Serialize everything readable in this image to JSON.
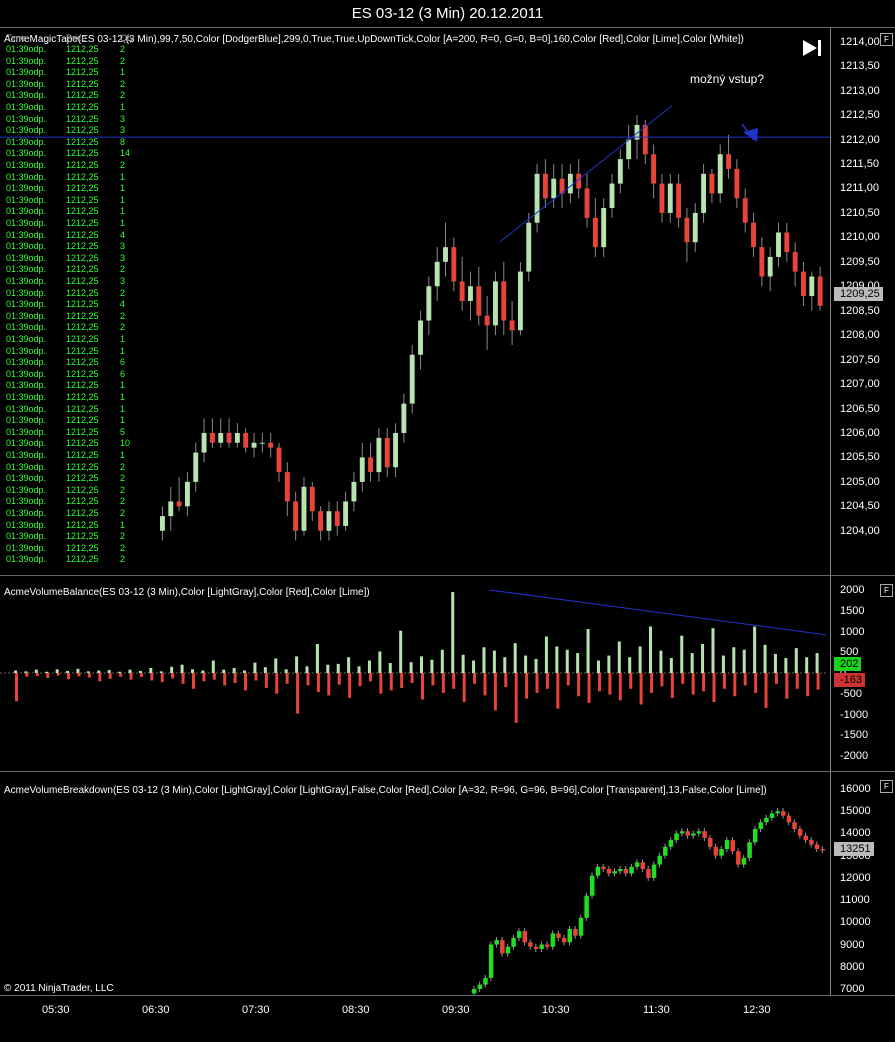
{
  "window": {
    "title": "ES 03-12 (3 Min)  20.12.2011"
  },
  "price_pane": {
    "indicator_label": "AcmeMagicTape(ES 03-12 (3 Min),99,7,50,Color [DodgerBlue],299,0,True,True,UpDownTick,Color [A=200, R=0, G=0, B=0],160,Color [Red],Color [Lime],Color [White])",
    "tape_header": [
      "Time",
      "Price",
      "Qty"
    ],
    "y_ticks": [
      "1214,00",
      "1213,50",
      "1213,00",
      "1212,50",
      "1212,00",
      "1211,50",
      "1211,00",
      "1210,50",
      "1210,00",
      "1209,50",
      "1209,00",
      "1208,50",
      "1208,00",
      "1207,50",
      "1207,00",
      "1206,50",
      "1206,00",
      "1205,50",
      "1205,00",
      "1204,50",
      "1204,00"
    ],
    "current_price": "1209,25",
    "annotation": "možný vstup?",
    "tape_rows": [
      [
        "01:39odp.",
        "1212,25",
        "2"
      ],
      [
        "01:39odp.",
        "1212,25",
        "2"
      ],
      [
        "01:39odp.",
        "1212,25",
        "1"
      ],
      [
        "01:39odp.",
        "1212,25",
        "2"
      ],
      [
        "01:39odp.",
        "1212,25",
        "2"
      ],
      [
        "01:39odp.",
        "1212,25",
        "1"
      ],
      [
        "01:39odp.",
        "1212,25",
        "3"
      ],
      [
        "01:39odp.",
        "1212,25",
        "3"
      ],
      [
        "01:39odp.",
        "1212,25",
        "8"
      ],
      [
        "01:39odp.",
        "1212,25",
        "14"
      ],
      [
        "01:39odp.",
        "1212,25",
        "2"
      ],
      [
        "01:39odp.",
        "1212,25",
        "1"
      ],
      [
        "01:39odp.",
        "1212,25",
        "1"
      ],
      [
        "01:39odp.",
        "1212,25",
        "1"
      ],
      [
        "01:39odp.",
        "1212,25",
        "1"
      ],
      [
        "01:39odp.",
        "1212,25",
        "1"
      ],
      [
        "01:39odp.",
        "1212,25",
        "4"
      ],
      [
        "01:39odp.",
        "1212,25",
        "3"
      ],
      [
        "01:39odp.",
        "1212,25",
        "3"
      ],
      [
        "01:39odp.",
        "1212,25",
        "2"
      ],
      [
        "01:39odp.",
        "1212,25",
        "3"
      ],
      [
        "01:39odp.",
        "1212,25",
        "2"
      ],
      [
        "01:39odp.",
        "1212,25",
        "4"
      ],
      [
        "01:39odp.",
        "1212,25",
        "2"
      ],
      [
        "01:39odp.",
        "1212,25",
        "2"
      ],
      [
        "01:39odp.",
        "1212,25",
        "1"
      ],
      [
        "01:39odp.",
        "1212,25",
        "1"
      ],
      [
        "01:39odp.",
        "1212,25",
        "6"
      ],
      [
        "01:39odp.",
        "1212,25",
        "6"
      ],
      [
        "01:39odp.",
        "1212,25",
        "1"
      ],
      [
        "01:39odp.",
        "1212,25",
        "1"
      ],
      [
        "01:39odp.",
        "1212,25",
        "1"
      ],
      [
        "01:39odp.",
        "1212,25",
        "1"
      ],
      [
        "01:39odp.",
        "1212,25",
        "5"
      ],
      [
        "01:39odp.",
        "1212,25",
        "10"
      ],
      [
        "01:39odp.",
        "1212,25",
        "1"
      ],
      [
        "01:39odp.",
        "1212,25",
        "2"
      ],
      [
        "01:39odp.",
        "1212,25",
        "2"
      ],
      [
        "01:39odp.",
        "1212,25",
        "2"
      ],
      [
        "01:39odp.",
        "1212,25",
        "2"
      ],
      [
        "01:39odp.",
        "1212,25",
        "2"
      ],
      [
        "01:39odp.",
        "1212,25",
        "1"
      ],
      [
        "01:39odp.",
        "1212,25",
        "2"
      ],
      [
        "01:39odp.",
        "1212,25",
        "2"
      ],
      [
        "01:39odp.",
        "1212,25",
        "2"
      ]
    ]
  },
  "balance_pane": {
    "indicator_label": "AcmeVolumeBalance(ES 03-12 (3 Min),Color [LightGray],Color [Red],Color [Lime])",
    "y_ticks": [
      "2000",
      "1500",
      "1000",
      "500",
      "0",
      "-500",
      "-1000",
      "-1500",
      "-2000"
    ],
    "buy_value": "202",
    "sell_value": "-163"
  },
  "breakdown_pane": {
    "indicator_label": "AcmeVolumeBreakdown(ES 03-12 (3 Min),Color [LightGray],Color [LightGray],False,Color [Red],Color [A=32, R=96, G=96, B=96],Color [Transparent],13,False,Color [Lime])",
    "y_ticks": [
      "16000",
      "15000",
      "14000",
      "13000",
      "12000",
      "11000",
      "10000",
      "9000",
      "8000",
      "7000"
    ],
    "current_value": "13251"
  },
  "x_axis": {
    "ticks": [
      "05:30",
      "06:30",
      "07:30",
      "08:30",
      "09:30",
      "10:30",
      "11:30",
      "12:30"
    ]
  },
  "footer": {
    "copyright": "© 2011 NinjaTrader, LLC"
  },
  "panel_button": "F",
  "colors": {
    "up": "#b7e3b0",
    "down": "#e8443a",
    "lime": "#22dd22",
    "trendline": "#2233cc",
    "tape_text": "#33ff33"
  },
  "chart_data": [
    {
      "type": "candlestick",
      "series_name": "ES 03-12 (3 Min)",
      "ylim": [
        1203.6,
        1214.3
      ],
      "x_ticks": [
        "05:30",
        "06:30",
        "07:30",
        "08:30",
        "09:30",
        "10:30",
        "11:30",
        "12:30"
      ],
      "candles_ohlc": [
        [
          1204.0,
          1204.5,
          1203.8,
          1204.3
        ],
        [
          1204.3,
          1204.9,
          1204.0,
          1204.6
        ],
        [
          1204.6,
          1205.1,
          1204.4,
          1204.5
        ],
        [
          1204.5,
          1205.2,
          1204.3,
          1205.0
        ],
        [
          1205.0,
          1205.8,
          1204.8,
          1205.6
        ],
        [
          1205.6,
          1206.3,
          1205.4,
          1206.0
        ],
        [
          1206.0,
          1206.3,
          1205.7,
          1205.8
        ],
        [
          1205.8,
          1206.3,
          1205.7,
          1206.0
        ],
        [
          1206.0,
          1206.3,
          1205.7,
          1205.8
        ],
        [
          1205.8,
          1206.2,
          1205.7,
          1206.0
        ],
        [
          1206.0,
          1206.1,
          1205.6,
          1205.7
        ],
        [
          1205.7,
          1206.0,
          1205.5,
          1205.8
        ],
        [
          1205.8,
          1206.0,
          1205.6,
          1205.8
        ],
        [
          1205.8,
          1206.0,
          1205.5,
          1205.7
        ],
        [
          1205.7,
          1205.8,
          1205.0,
          1205.2
        ],
        [
          1205.2,
          1205.4,
          1204.3,
          1204.6
        ],
        [
          1204.6,
          1204.8,
          1203.8,
          1204.0
        ],
        [
          1204.0,
          1205.1,
          1203.9,
          1204.9
        ],
        [
          1204.9,
          1205.0,
          1204.2,
          1204.4
        ],
        [
          1204.4,
          1204.5,
          1203.8,
          1204.0
        ],
        [
          1204.0,
          1204.6,
          1203.8,
          1204.4
        ],
        [
          1204.4,
          1204.6,
          1203.9,
          1204.1
        ],
        [
          1204.1,
          1204.8,
          1204.0,
          1204.6
        ],
        [
          1204.6,
          1205.2,
          1204.4,
          1205.0
        ],
        [
          1205.0,
          1205.8,
          1204.8,
          1205.5
        ],
        [
          1205.5,
          1205.8,
          1205.0,
          1205.2
        ],
        [
          1205.2,
          1206.1,
          1205.0,
          1205.9
        ],
        [
          1205.9,
          1206.1,
          1205.1,
          1205.3
        ],
        [
          1205.3,
          1206.2,
          1205.1,
          1206.0
        ],
        [
          1206.0,
          1206.8,
          1205.8,
          1206.6
        ],
        [
          1206.6,
          1207.8,
          1206.4,
          1207.6
        ],
        [
          1207.6,
          1208.5,
          1207.3,
          1208.3
        ],
        [
          1208.3,
          1209.2,
          1208.0,
          1209.0
        ],
        [
          1209.0,
          1209.8,
          1208.7,
          1209.5
        ],
        [
          1209.5,
          1210.3,
          1209.2,
          1209.8
        ],
        [
          1209.8,
          1210.0,
          1208.9,
          1209.1
        ],
        [
          1209.1,
          1209.6,
          1208.5,
          1208.7
        ],
        [
          1208.7,
          1209.3,
          1208.3,
          1209.0
        ],
        [
          1209.0,
          1209.4,
          1208.2,
          1208.4
        ],
        [
          1208.4,
          1208.8,
          1207.7,
          1208.2
        ],
        [
          1208.2,
          1209.3,
          1208.0,
          1209.1
        ],
        [
          1209.1,
          1209.5,
          1208.0,
          1208.3
        ],
        [
          1208.3,
          1208.7,
          1207.8,
          1208.1
        ],
        [
          1208.1,
          1209.5,
          1208.0,
          1209.3
        ],
        [
          1209.3,
          1210.5,
          1209.1,
          1210.3
        ],
        [
          1210.3,
          1211.5,
          1210.1,
          1211.3
        ],
        [
          1211.3,
          1211.6,
          1210.6,
          1210.8
        ],
        [
          1210.8,
          1211.5,
          1210.6,
          1211.2
        ],
        [
          1211.2,
          1211.5,
          1210.6,
          1210.9
        ],
        [
          1210.9,
          1211.5,
          1210.7,
          1211.3
        ],
        [
          1211.3,
          1211.6,
          1210.8,
          1211.0
        ],
        [
          1211.0,
          1211.3,
          1210.2,
          1210.4
        ],
        [
          1210.4,
          1210.8,
          1209.6,
          1209.8
        ],
        [
          1209.8,
          1210.8,
          1209.6,
          1210.6
        ],
        [
          1210.6,
          1211.3,
          1210.4,
          1211.1
        ],
        [
          1211.1,
          1211.8,
          1210.9,
          1211.6
        ],
        [
          1211.6,
          1212.3,
          1211.4,
          1212.0
        ],
        [
          1212.0,
          1212.5,
          1211.6,
          1212.3
        ],
        [
          1212.3,
          1212.4,
          1211.5,
          1211.7
        ],
        [
          1211.7,
          1211.9,
          1210.8,
          1211.1
        ],
        [
          1211.1,
          1211.3,
          1210.3,
          1210.5
        ],
        [
          1210.5,
          1211.3,
          1210.3,
          1211.1
        ],
        [
          1211.1,
          1211.3,
          1210.2,
          1210.4
        ],
        [
          1210.4,
          1210.6,
          1209.5,
          1209.9
        ],
        [
          1209.9,
          1210.7,
          1209.7,
          1210.5
        ],
        [
          1210.5,
          1211.5,
          1210.3,
          1211.3
        ],
        [
          1211.3,
          1211.4,
          1210.7,
          1210.9
        ],
        [
          1210.9,
          1211.9,
          1210.7,
          1211.7
        ],
        [
          1211.7,
          1212.1,
          1211.2,
          1211.4
        ],
        [
          1211.4,
          1211.6,
          1210.6,
          1210.8
        ],
        [
          1210.8,
          1211.0,
          1210.1,
          1210.3
        ],
        [
          1210.3,
          1210.5,
          1209.6,
          1209.8
        ],
        [
          1209.8,
          1210.0,
          1209.0,
          1209.2
        ],
        [
          1209.2,
          1209.8,
          1208.9,
          1209.6
        ],
        [
          1209.6,
          1210.3,
          1209.4,
          1210.1
        ],
        [
          1210.1,
          1210.3,
          1209.5,
          1209.7
        ],
        [
          1209.7,
          1209.9,
          1209.0,
          1209.3
        ],
        [
          1209.3,
          1209.5,
          1208.6,
          1208.8
        ],
        [
          1208.8,
          1209.3,
          1208.5,
          1209.2
        ],
        [
          1209.2,
          1209.4,
          1208.5,
          1208.6
        ]
      ],
      "horizontal_line": 1212.05,
      "trendline": {
        "from": [
          0.62,
          1209.9
        ],
        "to": [
          0.81,
          1212.7
        ]
      }
    },
    {
      "type": "bar",
      "series_name": "AcmeVolumeBalance",
      "ylim": [
        -2200,
        2200
      ],
      "buy": [
        60,
        40,
        80,
        30,
        90,
        50,
        100,
        40,
        60,
        70,
        30,
        80,
        50,
        120,
        40,
        150,
        200,
        90,
        60,
        300,
        80,
        120,
        60,
        250,
        140,
        350,
        90,
        400,
        160,
        700,
        200,
        220,
        380,
        160,
        300,
        520,
        240,
        1020,
        260,
        400,
        320,
        560,
        1950,
        440,
        300,
        620,
        540,
        380,
        720,
        420,
        340,
        880,
        640,
        560,
        480,
        1060,
        300,
        420,
        760,
        380,
        640,
        1120,
        540,
        360,
        900,
        480,
        700,
        1080,
        420,
        620,
        560,
        1120,
        680,
        460,
        360,
        600,
        380,
        480
      ],
      "sell": [
        -680,
        -90,
        -70,
        -120,
        -60,
        -150,
        -80,
        -110,
        -200,
        -140,
        -90,
        -160,
        -100,
        -180,
        -220,
        -130,
        -260,
        -380,
        -200,
        -160,
        -300,
        -240,
        -420,
        -180,
        -360,
        -500,
        -260,
        -980,
        -300,
        -460,
        -540,
        -280,
        -600,
        -320,
        -200,
        -500,
        -420,
        -360,
        -240,
        -640,
        -300,
        -480,
        -380,
        -700,
        -260,
        -540,
        -900,
        -340,
        -1200,
        -620,
        -480,
        -380,
        -860,
        -300,
        -560,
        -720,
        -440,
        -520,
        -660,
        -380,
        -760,
        -480,
        -320,
        -600,
        -260,
        -520,
        -440,
        -700,
        -380,
        -560,
        -300,
        -480,
        -840,
        -260,
        -620,
        -380,
        -560,
        -400
      ],
      "trendline": {
        "from": [
          0.59,
          2000
        ],
        "to": [
          1.0,
          920
        ]
      }
    },
    {
      "type": "bar",
      "series_name": "AcmeVolumeBreakdown",
      "ylim": [
        6700,
        16300
      ],
      "values": [
        7000,
        7200,
        7500,
        9000,
        9200,
        8600,
        8900,
        9300,
        9600,
        9100,
        8900,
        8800,
        9000,
        8900,
        9500,
        9300,
        9100,
        9700,
        9400,
        10200,
        11200,
        12100,
        12500,
        12400,
        12200,
        12300,
        12400,
        12200,
        12500,
        12700,
        12400,
        12000,
        12600,
        13000,
        13400,
        13700,
        14000,
        14100,
        13900,
        14000,
        14100,
        13800,
        13400,
        13000,
        13300,
        13700,
        13200,
        12600,
        12900,
        13600,
        14200,
        14500,
        14700,
        14900,
        15000,
        14800,
        14500,
        14200,
        13900,
        13700,
        13500,
        13300,
        13251
      ]
    }
  ]
}
